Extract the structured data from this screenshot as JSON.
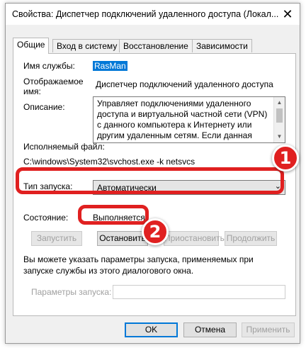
{
  "window": {
    "title": "Свойства: Диспетчер подключений удаленного доступа (Локал...",
    "close_glyph": "✕"
  },
  "tabs": [
    {
      "label": "Общие",
      "active": true
    },
    {
      "label": "Вход в систему",
      "active": false
    },
    {
      "label": "Восстановление",
      "active": false
    },
    {
      "label": "Зависимости",
      "active": false
    }
  ],
  "general": {
    "service_name_label": "Имя службы:",
    "service_name_value": "RasMan",
    "display_name_label_line1": "Отображаемое",
    "display_name_label_line2": "имя:",
    "display_name_value": "Диспетчер подключений удаленного доступа",
    "description_label": "Описание:",
    "description_value": "Управляет подключениями удаленного доступа и виртуальной частной сети (VPN) с данного компьютера к Интернету или другим удаленным сетям. Если данная служба",
    "exe_label": "Исполняемый файл:",
    "exe_value": "C:\\windows\\System32\\svchost.exe -k netsvcs",
    "startup_type_label": "Тип запуска:",
    "startup_type_value": "Автоматически",
    "status_label": "Состояние:",
    "status_value": "Выполняется",
    "buttons": {
      "start": "Запустить",
      "stop": "Остановить",
      "pause": "Приостановить",
      "resume": "Продолжить"
    },
    "hint": "Вы можете указать параметры запуска, применяемых при запуске службы из этого диалогового окна.",
    "params_label": "Параметры запуска:",
    "params_value": ""
  },
  "footer": {
    "ok": "OK",
    "cancel": "Отмена",
    "apply": "Применить"
  },
  "annotations": [
    {
      "number": "1",
      "color": "#e02020"
    },
    {
      "number": "2",
      "color": "#e02020"
    }
  ],
  "colors": {
    "accent": "#0078d7",
    "highlight": "#e02020"
  }
}
